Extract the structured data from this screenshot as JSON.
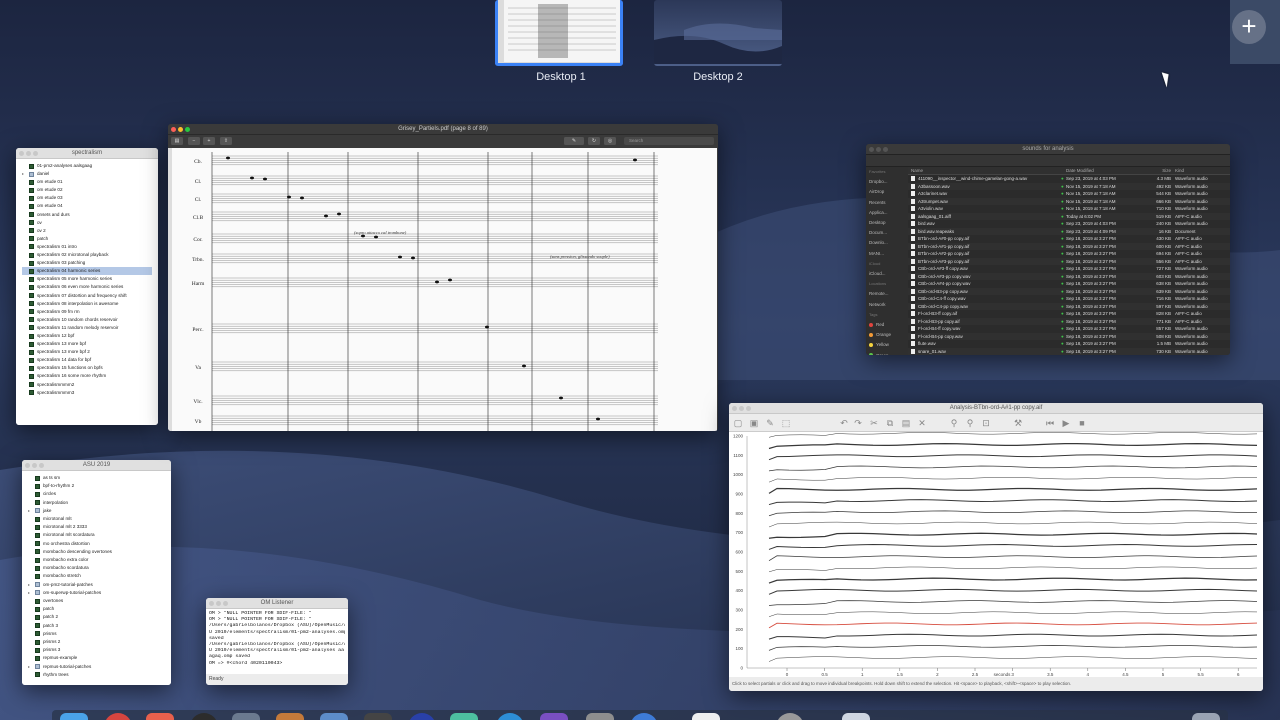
{
  "spaces": {
    "desktops": [
      {
        "label": "Desktop 1",
        "active": true
      },
      {
        "label": "Desktop 2",
        "active": false
      }
    ],
    "add_label": "+"
  },
  "spectralism_window": {
    "title": "spectralism",
    "items": [
      {
        "label": "01-pm2-analyses aalsgaag",
        "type": "patch"
      },
      {
        "label": "daniel",
        "type": "folder"
      },
      {
        "label": "om etude 01",
        "type": "patch"
      },
      {
        "label": "om etude 02",
        "type": "patch"
      },
      {
        "label": "om etude 03",
        "type": "patch"
      },
      {
        "label": "om etude 04",
        "type": "patch"
      },
      {
        "label": "onsets and durs",
        "type": "patch"
      },
      {
        "label": "ov",
        "type": "patch"
      },
      {
        "label": "ov 2",
        "type": "patch"
      },
      {
        "label": "patch",
        "type": "patch"
      },
      {
        "label": "spectralism 01 intro",
        "type": "patch"
      },
      {
        "label": "spectralism 02 microtonal playback",
        "type": "patch"
      },
      {
        "label": "spectralism 03 patching",
        "type": "patch"
      },
      {
        "label": "spectralism 04 harmonic series",
        "type": "patch",
        "selected": true
      },
      {
        "label": "spectralism 05 more harmonic series",
        "type": "patch"
      },
      {
        "label": "spectralism 06 even more harmonic series",
        "type": "patch"
      },
      {
        "label": "spectralism 07 distortion and frequency shift",
        "type": "patch"
      },
      {
        "label": "spectralism 08 interpolation is awesome",
        "type": "patch"
      },
      {
        "label": "spectralism 09 fm rm",
        "type": "patch"
      },
      {
        "label": "spectralism 10 random chords reservoir",
        "type": "patch"
      },
      {
        "label": "spectralism 11 random melody reservoir",
        "type": "patch"
      },
      {
        "label": "spectralism 12 bpf",
        "type": "patch"
      },
      {
        "label": "spectralism 13 more bpf",
        "type": "patch"
      },
      {
        "label": "spectralism 13 more bpf 2",
        "type": "patch"
      },
      {
        "label": "spectralism 14 data for bpf",
        "type": "patch"
      },
      {
        "label": "spectralism 15 functions on bpfs",
        "type": "patch"
      },
      {
        "label": "spectralism 16 some more rhythm",
        "type": "patch"
      },
      {
        "label": "spectralismmmm2",
        "type": "patch"
      },
      {
        "label": "spectralismmmm3",
        "type": "patch"
      }
    ]
  },
  "asu_window": {
    "title": "ASU 2019",
    "items": [
      {
        "label": "as ts sm",
        "type": "patch"
      },
      {
        "label": "bpf-to-rhythm 2",
        "type": "patch"
      },
      {
        "label": "circles",
        "type": "patch"
      },
      {
        "label": "interpolation",
        "type": "patch"
      },
      {
        "label": "jake",
        "type": "folder"
      },
      {
        "label": "microtonal mlt",
        "type": "patch"
      },
      {
        "label": "microtonal mlt 2 3333",
        "type": "patch"
      },
      {
        "label": "microtonal mlt scordatura",
        "type": "patch"
      },
      {
        "label": "mo orchestra distortion",
        "type": "patch"
      },
      {
        "label": "mombacho descending overtones",
        "type": "patch"
      },
      {
        "label": "mombacho extra color",
        "type": "patch"
      },
      {
        "label": "mombacho scordatura",
        "type": "patch"
      },
      {
        "label": "mombacho stretch",
        "type": "patch"
      },
      {
        "label": "om-pm2-tutorial-patches",
        "type": "folder"
      },
      {
        "label": "om-superwp-tutorial-patches",
        "type": "folder"
      },
      {
        "label": "overtones",
        "type": "patch"
      },
      {
        "label": "patch",
        "type": "patch"
      },
      {
        "label": "patch 2",
        "type": "patch"
      },
      {
        "label": "patch 3",
        "type": "patch"
      },
      {
        "label": "prisms",
        "type": "patch"
      },
      {
        "label": "prisms 2",
        "type": "patch"
      },
      {
        "label": "prisms 3",
        "type": "patch"
      },
      {
        "label": "repmus-example",
        "type": "patch"
      },
      {
        "label": "repmus-tutorial-patches",
        "type": "folder"
      },
      {
        "label": "rhythm trees",
        "type": "patch"
      }
    ]
  },
  "pdf_window": {
    "title": "Grisey_Partiels.pdf (page 8 of 89)",
    "search_placeholder": "Search",
    "instruments": [
      "Cb.",
      "Cl.",
      "Cl.",
      "Cl.B",
      "Cor.",
      "Trbn.",
      "Harm",
      "Perc.",
      "Va",
      "Vlc.",
      "Vb"
    ],
    "annotations": [
      "(sopro attacco cal trombone)",
      "(sans pression, glissando souple)"
    ]
  },
  "finder_window": {
    "title": "sounds for analysis",
    "sidebar": {
      "favorites_head": "Favorites",
      "favorites": [
        "Dropbo...",
        "AirDrop",
        "Recents",
        "Applica...",
        "Desktop",
        "Docum...",
        "Downlo...",
        "MANI..."
      ],
      "icloud_head": "iCloud",
      "icloud": [
        "iCloud..."
      ],
      "locations_head": "Locations",
      "locations": [
        "Remote...",
        "Network"
      ],
      "tags_head": "Tags",
      "tags": [
        {
          "label": "Red",
          "color": "#e0443e"
        },
        {
          "label": "Orange",
          "color": "#f29a36"
        },
        {
          "label": "Yellow",
          "color": "#f5d33e"
        },
        {
          "label": "Green",
          "color": "#5cc448"
        }
      ]
    },
    "columns": [
      "Name",
      "Date Modified",
      "Size",
      "Kind"
    ],
    "rows": [
      [
        "411090__inspector__wind-chime-gamelan-gong-a.wav",
        "Sep 23, 2019 at 4:03 PM",
        "4.3 MB",
        "Waveform audio"
      ],
      [
        "A3bassoon.wav",
        "Nov 15, 2019 at 7:18 AM",
        "492 KB",
        "Waveform audio"
      ],
      [
        "A3clarinet.wav",
        "Nov 15, 2019 at 7:18 AM",
        "544 KB",
        "Waveform audio"
      ],
      [
        "A3trumpet.wav",
        "Nov 15, 2019 at 7:18 AM",
        "666 KB",
        "Waveform audio"
      ],
      [
        "A3violin.wav",
        "Nov 15, 2019 at 7:18 AM",
        "710 KB",
        "Waveform audio"
      ],
      [
        "aalsgaag_01.aiff",
        "Today at 6:02 PM",
        "519 KB",
        "AIFF-C audio"
      ],
      [
        "bird.wav",
        "Sep 23, 2019 at 4:03 PM",
        "240 KB",
        "Waveform audio"
      ],
      [
        "bird.wav.reapeaks",
        "Sep 23, 2019 at 4:09 PM",
        "16 KB",
        "Document"
      ],
      [
        "BTbn-ord-A#0-pp copy.aif",
        "Sep 18, 2019 at 3:27 PM",
        "430 KB",
        "AIFF-C audio"
      ],
      [
        "BTbn-ord-A#1-pp copy.aif",
        "Sep 18, 2019 at 3:27 PM",
        "600 KB",
        "AIFF-C audio"
      ],
      [
        "BTbn-ord-A#2-pp copy.aif",
        "Sep 18, 2019 at 3:27 PM",
        "694 KB",
        "AIFF-C audio"
      ],
      [
        "BTbn-ord-A#3-pp copy.aif",
        "Sep 18, 2019 at 3:27 PM",
        "556 KB",
        "AIFF-C audio"
      ],
      [
        "CBb-ord-A#3-ff copy.wav",
        "Sep 18, 2019 at 3:27 PM",
        "727 KB",
        "Waveform audio"
      ],
      [
        "CBb-ord-A#3-pp copy.wav",
        "Sep 18, 2019 at 3:27 PM",
        "603 KB",
        "Waveform audio"
      ],
      [
        "CBb-ord-A#4-pp copy.wav",
        "Sep 18, 2019 at 3:27 PM",
        "638 KB",
        "Waveform audio"
      ],
      [
        "CBb-ord-B3-pp copy.wav",
        "Sep 18, 2019 at 3:27 PM",
        "639 KB",
        "Waveform audio"
      ],
      [
        "CBb-ord-C4-ff copy.wav",
        "Sep 18, 2019 at 3:27 PM",
        "716 KB",
        "Waveform audio"
      ],
      [
        "CBb-ord-C4-pp copy.wav",
        "Sep 18, 2019 at 3:27 PM",
        "597 KB",
        "Waveform audio"
      ],
      [
        "Fl-ord-B3-ff copy.aif",
        "Sep 18, 2019 at 3:27 PM",
        "828 KB",
        "AIFF-C audio"
      ],
      [
        "Fl-ord-B3-pp copy.aif",
        "Sep 18, 2019 at 3:27 PM",
        "771 KB",
        "AIFF-C audio"
      ],
      [
        "Fl-ord-B4-ff copy.wav",
        "Sep 18, 2019 at 3:27 PM",
        "857 KB",
        "Waveform audio"
      ],
      [
        "Fl-ord-B4-pp copy.wav",
        "Sep 18, 2019 at 3:27 PM",
        "508 KB",
        "Waveform audio"
      ],
      [
        "flute.wav",
        "Sep 18, 2019 at 3:27 PM",
        "1.5 MB",
        "Waveform audio"
      ],
      [
        "snare_01.wav",
        "Sep 18, 2019 at 3:27 PM",
        "730 KB",
        "Waveform audio"
      ]
    ]
  },
  "analysis_window": {
    "title": "Analysis-BTbn-ord-A#1-pp copy.aif",
    "status": "Click to select partials or click and drag to move individual breakpoints. Hold down shift to extend the selection. Hit <space> to playback, <shift>-<space> to play selection.",
    "x_label": "seconds",
    "y_ticks": [
      1200,
      1100,
      1000,
      900,
      800,
      700,
      600,
      500,
      400,
      300,
      200,
      100,
      0
    ],
    "x_ticks": [
      "0",
      "0.5",
      "1",
      "1.5",
      "2",
      "2.5",
      "3",
      "3.5",
      "4",
      "4.5",
      "5",
      "5.5",
      "6"
    ],
    "accent": "#d23a2a"
  },
  "listener_window": {
    "title": "OM Listener",
    "lines": [
      "OM > \"NULL POINTER FOR SDIF-FILE: \"",
      "OM > \"NULL POINTER FOR SDIF-FILE: \"",
      "/Users/gabrielbolanos/Dropbox (ASU)/OpenMusic/AS",
      "U 2019/elements/spectralism/01-pm2-analyses.omp",
      "saved",
      "/Users/gabrielbolanos/Dropbox (ASU)/OpenMusic/AS",
      "U 2019/elements/spectralism/01-pm2-analyses aals",
      "agaq.omp saved",
      "OM => #<chord 4020110043>"
    ],
    "status": "Ready"
  }
}
